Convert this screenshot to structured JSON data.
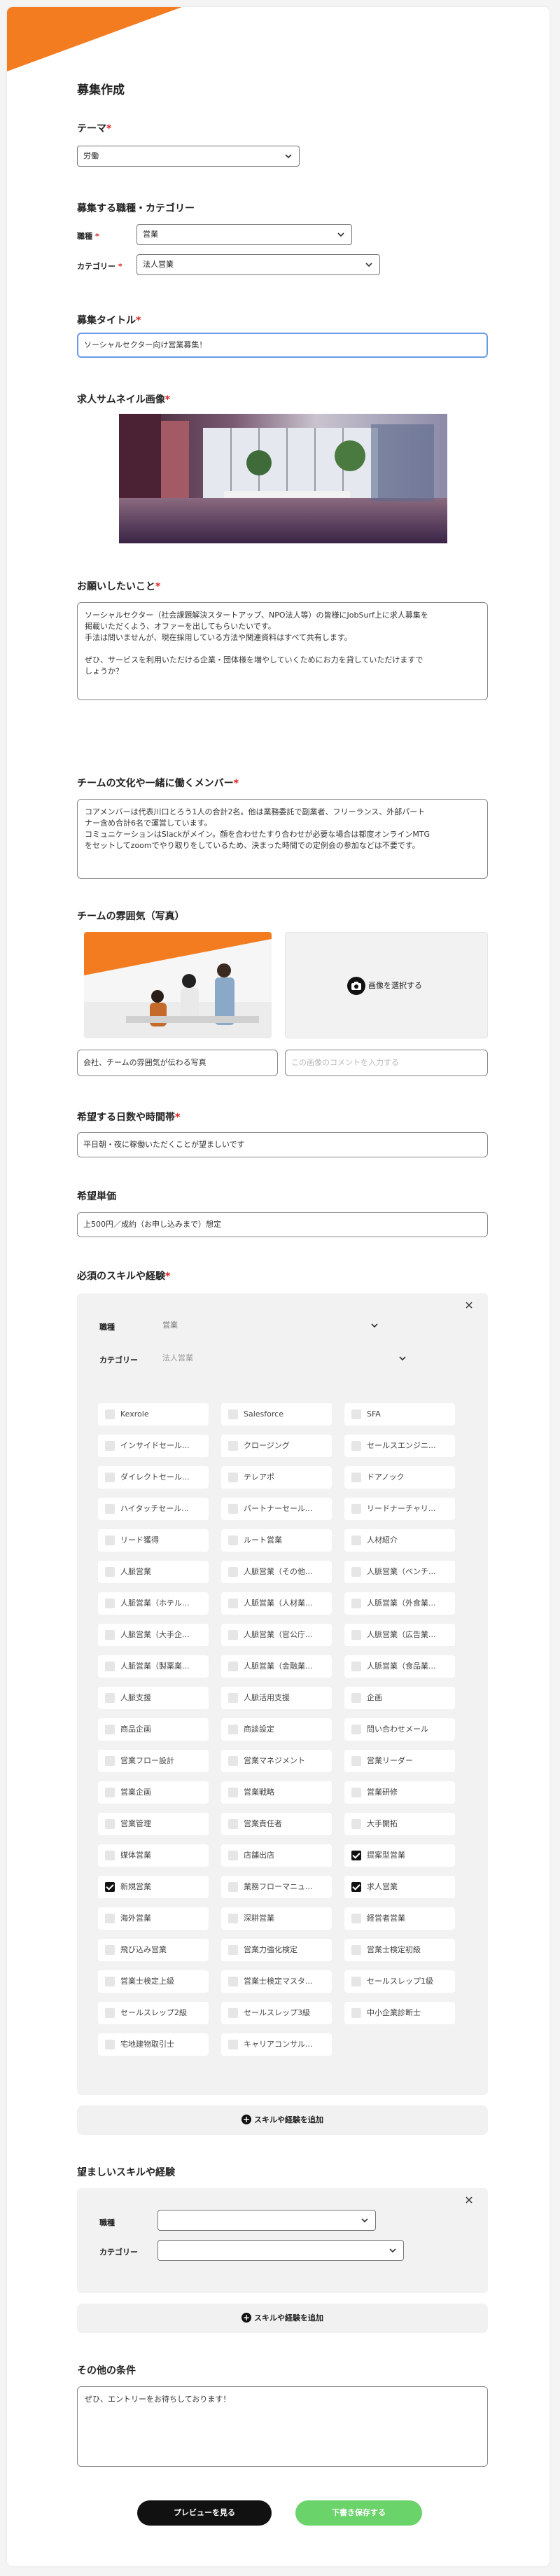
{
  "page": {
    "title": "募集作成"
  },
  "colors": {
    "accent": "#f47c20",
    "required": "#e02020",
    "primary_button": "#111111",
    "submit_button": "#6ad36a",
    "focus_border": "#6a9be6"
  },
  "theme": {
    "label": "テーマ",
    "req": "*",
    "value": "労働"
  },
  "job_category": {
    "heading": "募集する職種・カテゴリー",
    "occupation_label": "職種",
    "occupation_req": "*",
    "occupation_value": "営業",
    "category_label": "カテゴリー",
    "category_req": "*",
    "category_value": "法人営業"
  },
  "job_title": {
    "label": "募集タイトル",
    "req": "*",
    "value": "ソーシャルセクター向け営業募集！"
  },
  "thumbnail": {
    "label": "求人サムネイル画像",
    "req": "*"
  },
  "request": {
    "label": "お願いしたいこと",
    "req": "*",
    "value": "ソーシャルセクター（社会課題解決スタートアップ、NPO法人等）の皆様にJobSurf上に求人募集を\n掲載いただくよう、オファーを出してもらいたいです。\n手法は問いませんが、現在採用している方法や関連資料はすべて共有します。\n\nぜひ、サービスを利用いただける企業・団体様を増やしていくためにお力を貸していただけますで\nしょうか？"
  },
  "team_culture": {
    "label": "チームの文化や一緒に働くメンバー",
    "req": "*",
    "value": "コアメンバーは代表川口とろう1人の合計2名。他は業務委託で副業者、フリーランス、外部パート\nナー含め合計6名で運営しています。\nコミュニケーションはSlackがメイン。顔を合わせたすり合わせが必要な場合は都度オンラインMTG\nをセットしてzoomでやり取りをしているため、決まった時間での定例会の参加などは不要です。"
  },
  "team_photos": {
    "label": "チームの雰囲気（写真）",
    "caption1_value": "会社、チームの雰囲気が伝わる写真",
    "select_label": "画像を選択する",
    "caption2_placeholder": "この画像のコメントを入力する"
  },
  "work_days": {
    "label": "希望する日数や時間帯",
    "req": "*",
    "value": "平日朝・夜に稼働いただくことが望ましいです"
  },
  "unit_price": {
    "label": "希望単価",
    "value": "上500円／成約（お申し込みまで）想定"
  },
  "required_skills": {
    "label": "必須のスキルや経験",
    "req": "*",
    "occupation_label": "職種",
    "occupation_value": "営業",
    "category_label": "カテゴリー",
    "category_value": "法人営業",
    "options": [
      {
        "label": "Kexrole",
        "checked": false
      },
      {
        "label": "Salesforce",
        "checked": false
      },
      {
        "label": "SFA",
        "checked": false
      },
      {
        "label": "インサイドセール...",
        "checked": false
      },
      {
        "label": "クロージング",
        "checked": false
      },
      {
        "label": "セールスエンジニ...",
        "checked": false
      },
      {
        "label": "ダイレクトセール...",
        "checked": false
      },
      {
        "label": "テレアポ",
        "checked": false
      },
      {
        "label": "ドアノック",
        "checked": false
      },
      {
        "label": "ハイタッチセール...",
        "checked": false
      },
      {
        "label": "パートナーセール...",
        "checked": false
      },
      {
        "label": "リードナーチャリ...",
        "checked": false
      },
      {
        "label": "リード獲得",
        "checked": false
      },
      {
        "label": "ルート営業",
        "checked": false
      },
      {
        "label": "人材紹介",
        "checked": false
      },
      {
        "label": "人脈営業",
        "checked": false
      },
      {
        "label": "人脈営業（その他...",
        "checked": false
      },
      {
        "label": "人脈営業（ベンチ...",
        "checked": false
      },
      {
        "label": "人脈営業（ホテル...",
        "checked": false
      },
      {
        "label": "人脈営業（人材業...",
        "checked": false
      },
      {
        "label": "人脈営業（外食業...",
        "checked": false
      },
      {
        "label": "人脈営業（大手企...",
        "checked": false
      },
      {
        "label": "人脈営業（官公庁...",
        "checked": false
      },
      {
        "label": "人脈営業（広告業...",
        "checked": false
      },
      {
        "label": "人脈営業（製薬業...",
        "checked": false
      },
      {
        "label": "人脈営業（金融業...",
        "checked": false
      },
      {
        "label": "人脈営業（食品業...",
        "checked": false
      },
      {
        "label": "人脈支援",
        "checked": false
      },
      {
        "label": "人脈活用支援",
        "checked": false
      },
      {
        "label": "企画",
        "checked": false
      },
      {
        "label": "商品企画",
        "checked": false
      },
      {
        "label": "商談設定",
        "checked": false
      },
      {
        "label": "問い合わせメール",
        "checked": false
      },
      {
        "label": "営業フロー設計",
        "checked": false
      },
      {
        "label": "営業マネジメント",
        "checked": false
      },
      {
        "label": "営業リーダー",
        "checked": false
      },
      {
        "label": "営業企画",
        "checked": false
      },
      {
        "label": "営業戦略",
        "checked": false
      },
      {
        "label": "営業研修",
        "checked": false
      },
      {
        "label": "営業管理",
        "checked": false
      },
      {
        "label": "営業責任者",
        "checked": false
      },
      {
        "label": "大手開拓",
        "checked": false
      },
      {
        "label": "媒体営業",
        "checked": false
      },
      {
        "label": "店舗出店",
        "checked": false
      },
      {
        "label": "提案型営業",
        "checked": true
      },
      {
        "label": "新規営業",
        "checked": true
      },
      {
        "label": "業務フローマニュ...",
        "checked": false
      },
      {
        "label": "求人営業",
        "checked": true
      },
      {
        "label": "海外営業",
        "checked": false
      },
      {
        "label": "深耕営業",
        "checked": false
      },
      {
        "label": "経営者営業",
        "checked": false
      },
      {
        "label": "飛び込み営業",
        "checked": false
      },
      {
        "label": "営業力強化検定",
        "checked": false
      },
      {
        "label": "営業士検定初級",
        "checked": false
      },
      {
        "label": "営業士検定上級",
        "checked": false
      },
      {
        "label": "営業士検定マスタ...",
        "checked": false
      },
      {
        "label": "セールスレップ1級",
        "checked": false
      },
      {
        "label": "セールスレップ2級",
        "checked": false
      },
      {
        "label": "セールスレップ3級",
        "checked": false
      },
      {
        "label": "中小企業診断士",
        "checked": false
      },
      {
        "label": "宅地建物取引士",
        "checked": false
      },
      {
        "label": "キャリアコンサル...",
        "checked": false
      }
    ],
    "add_label": "スキルや経験を追加"
  },
  "preferred_skills": {
    "label": "望ましいスキルや経験",
    "occupation_label": "職種",
    "occupation_value": "",
    "category_label": "カテゴリー",
    "category_value": "",
    "add_label": "スキルや経験を追加"
  },
  "other": {
    "label": "その他の条件",
    "value": "ぜひ、エントリーをお待ちしております！"
  },
  "actions": {
    "preview_label": "プレビューを見る",
    "submit_label": "下書き保存する"
  },
  "icons": {
    "chevron": "chevron-down-icon",
    "close": "close-icon",
    "camera": "camera-icon",
    "plus": "plus-icon"
  }
}
